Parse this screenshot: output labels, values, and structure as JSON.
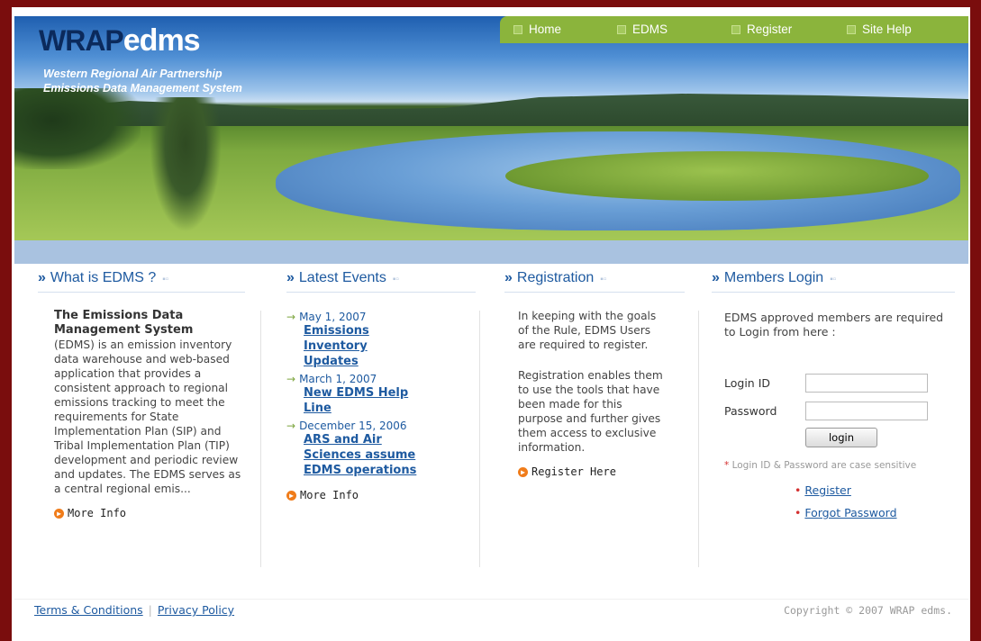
{
  "header": {
    "logo_main": "WRAP",
    "logo_sub": "edms",
    "tagline_line1": "Western Regional Air Partnership",
    "tagline_line2": "Emissions Data Management System"
  },
  "nav": {
    "items": [
      "Home",
      "EDMS",
      "Register",
      "Site Help"
    ]
  },
  "what": {
    "heading": "What is EDMS ?",
    "title": "The Emissions Data Management System",
    "body": "(EDMS) is an emission inventory data warehouse and web-based application that provides a consistent approach to regional emissions tracking to meet the requirements for State Implementation Plan (SIP) and Tribal Implementation Plan (TIP) development and periodic review and updates. The EDMS serves as a central regional emis...",
    "more": "More Info"
  },
  "events": {
    "heading": "Latest Events",
    "items": [
      {
        "date": "May 1, 2007",
        "title": "Emissions Inventory Updates"
      },
      {
        "date": "March 1, 2007",
        "title": "New EDMS Help Line"
      },
      {
        "date": "December 15, 2006",
        "title": "ARS and Air Sciences assume EDMS operations"
      }
    ],
    "more": "More Info"
  },
  "registration": {
    "heading": "Registration",
    "para1": "In keeping with the goals of the Rule, EDMS Users are required to register.",
    "para2": "Registration enables them to use the tools that have been made for this purpose and further gives them access to exclusive information.",
    "link": "Register Here"
  },
  "login": {
    "heading": "Members Login",
    "intro": "EDMS approved members are required to Login from here :",
    "id_label": "Login ID",
    "password_label": "Password",
    "button": "login",
    "note": "Login ID & Password are case sensitive",
    "links": [
      "Register",
      "Forgot Password"
    ]
  },
  "footer": {
    "terms": "Terms & Conditions",
    "privacy": "Privacy Policy",
    "copyright": "Copyright © 2007 WRAP edms."
  }
}
